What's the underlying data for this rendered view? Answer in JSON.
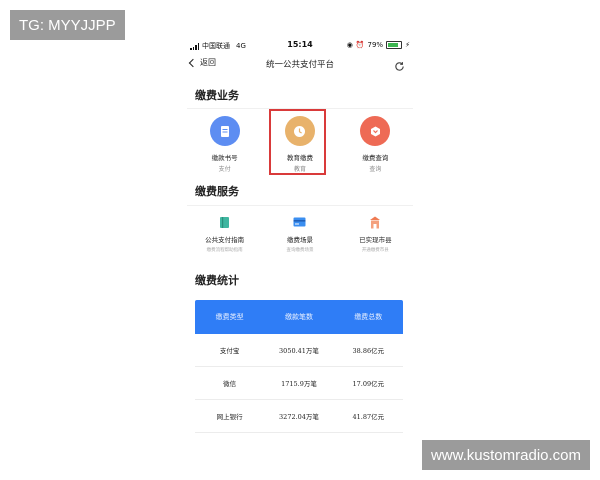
{
  "watermarks": {
    "top_left": "TG: MYYJJPP",
    "bottom_right": "www.kustomradio.com"
  },
  "status_bar": {
    "carrier": "中国联通",
    "network": "4G",
    "time": "15:14",
    "battery_percent": "79%",
    "battery_level": 0.79
  },
  "nav": {
    "back_label": "返回",
    "title": "统一公共支付平台"
  },
  "section_payment": {
    "title": "缴费业务",
    "items": [
      {
        "label": "缴款书号",
        "sub": "支付"
      },
      {
        "label": "教育缴费",
        "sub": "教育"
      },
      {
        "label": "缴费查询",
        "sub": "查询"
      }
    ]
  },
  "section_service": {
    "title": "缴费服务",
    "items": [
      {
        "label": "公共支付指南",
        "sub": "缴费流程帮助指南"
      },
      {
        "label": "缴费场景",
        "sub": "查询缴费场景"
      },
      {
        "label": "已实现市县",
        "sub": "开通缴费市县"
      }
    ]
  },
  "section_stats": {
    "title": "缴费统计",
    "headers": [
      "缴费类型",
      "缴款笔数",
      "缴费总数"
    ],
    "rows": [
      [
        "支付宝",
        "3050.41万笔",
        "38.86亿元"
      ],
      [
        "微信",
        "1715.9万笔",
        "17.09亿元"
      ],
      [
        "网上银行",
        "3272.04万笔",
        "41.87亿元"
      ]
    ]
  }
}
